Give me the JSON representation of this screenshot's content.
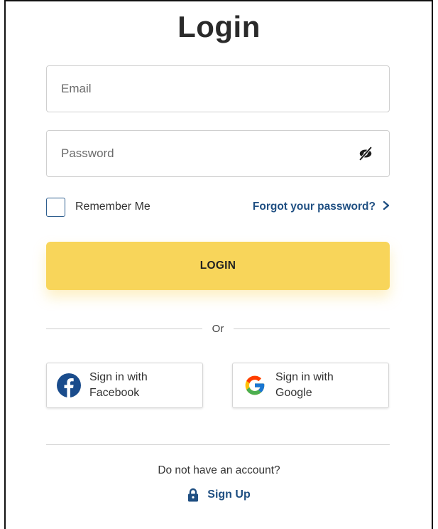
{
  "title": "Login",
  "email": {
    "placeholder": "Email",
    "value": ""
  },
  "password": {
    "placeholder": "Password",
    "value": "",
    "toggle_icon": "eye-slash-icon"
  },
  "remember": {
    "label": "Remember Me",
    "checked": false
  },
  "forgot": {
    "label": "Forgot your password?",
    "icon": "chevron-right-icon"
  },
  "login_button": {
    "label": "LOGIN"
  },
  "divider": {
    "label": "Or"
  },
  "social": {
    "facebook": {
      "label": "Sign in with Facebook",
      "icon": "facebook-icon"
    },
    "google": {
      "label": "Sign in with Google",
      "icon": "google-icon"
    }
  },
  "footer": {
    "prompt": "Do not have an account?",
    "signup_label": "Sign Up",
    "signup_icon": "lock-icon"
  },
  "colors": {
    "accent_yellow": "#f8d55a",
    "link_blue": "#1f4f82",
    "facebook_blue": "#1a4c8c"
  }
}
